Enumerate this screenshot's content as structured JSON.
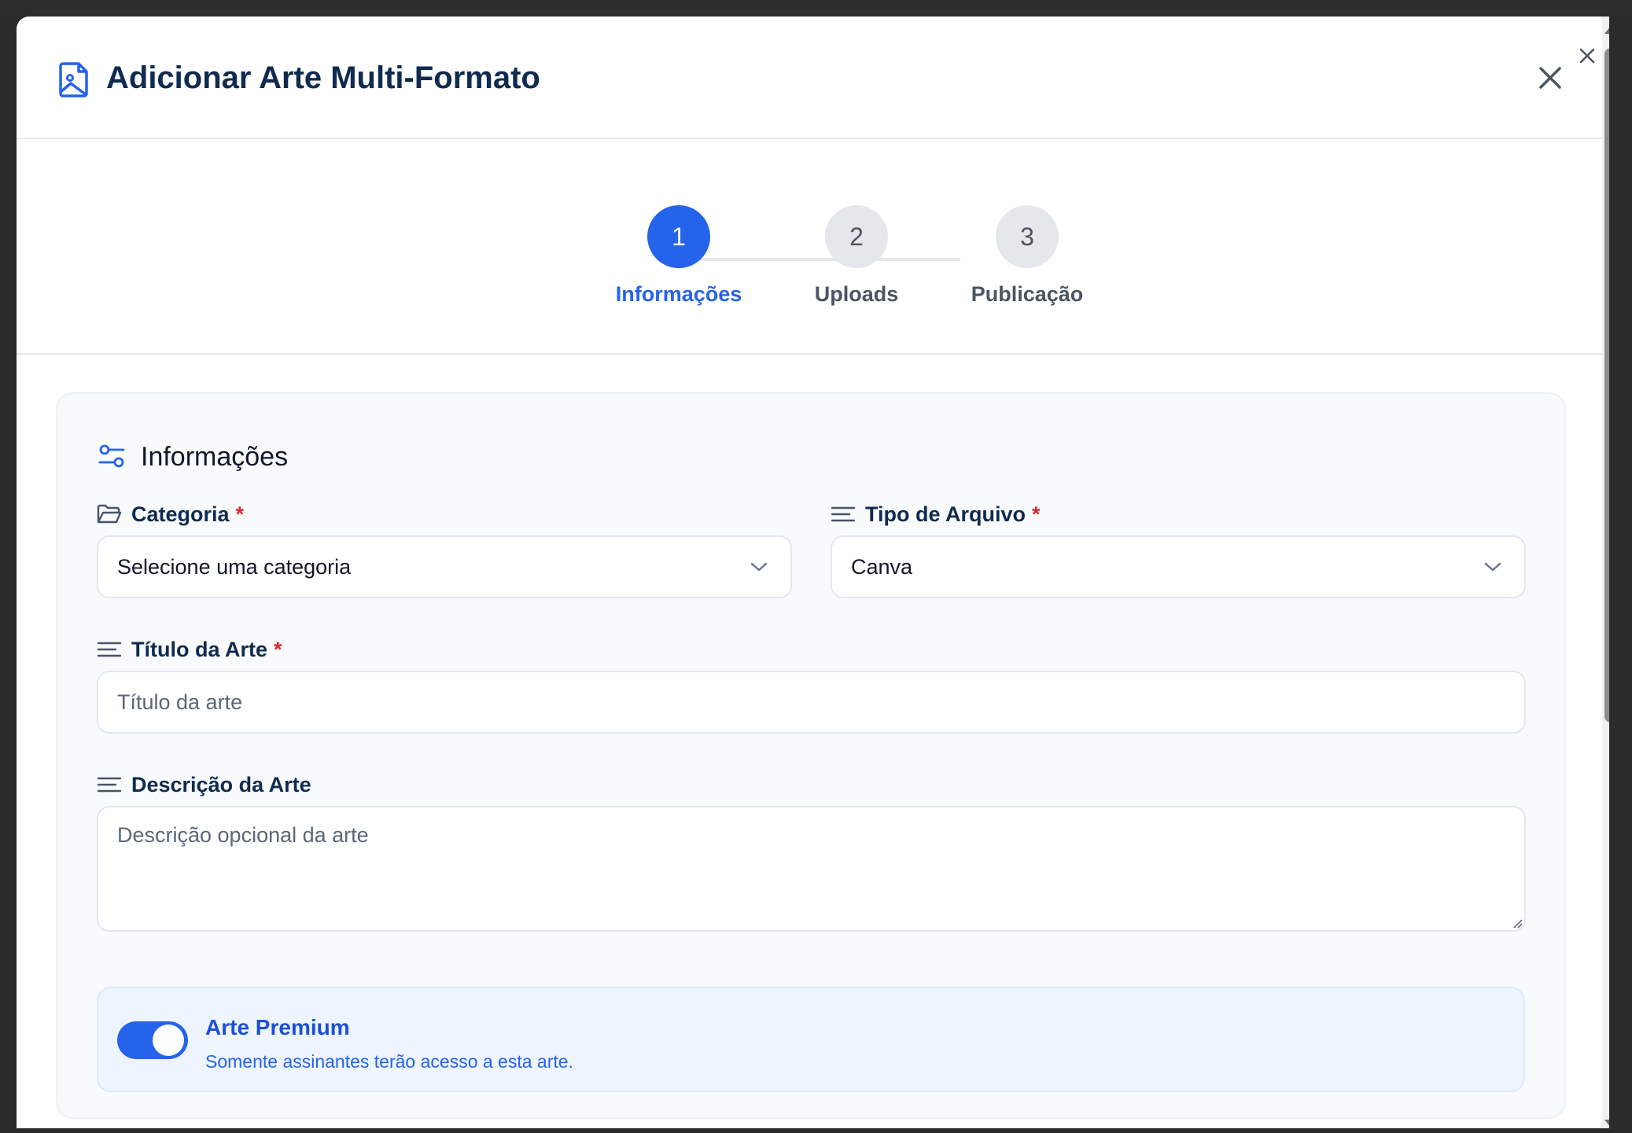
{
  "modal": {
    "title": "Adicionar Arte Multi-Formato",
    "title_icon": "file-image-icon",
    "close_icon": "close-icon"
  },
  "stepper": {
    "steps": [
      {
        "number": "1",
        "label": "Informações",
        "active": true
      },
      {
        "number": "2",
        "label": "Uploads",
        "active": false
      },
      {
        "number": "3",
        "label": "Publicação",
        "active": false
      }
    ]
  },
  "section": {
    "title": "Informações",
    "icon": "sliders-icon"
  },
  "fields": {
    "category": {
      "label": "Categoria",
      "required": "*",
      "value": "Selecione uma categoria",
      "icon": "folder-icon"
    },
    "file_type": {
      "label": "Tipo de Arquivo",
      "required": "*",
      "value": "Canva",
      "icon": "text-lines-icon"
    },
    "title": {
      "label": "Título da Arte",
      "required": "*",
      "placeholder": "Título da arte",
      "icon": "text-lines-icon"
    },
    "description": {
      "label": "Descrição da Arte",
      "placeholder": "Descrição opcional da arte",
      "icon": "text-lines-icon"
    }
  },
  "premium": {
    "title": "Arte Premium",
    "description": "Somente assinantes terão acesso a esta arte.",
    "enabled": true
  },
  "colors": {
    "accent": "#2563eb",
    "title_text": "#0f2b4f",
    "required": "#dc2626"
  }
}
